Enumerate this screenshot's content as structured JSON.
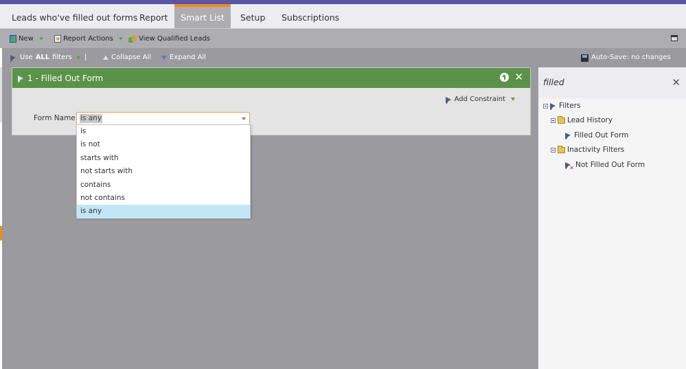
{
  "tabs": [
    {
      "label": "Leads who've filled out forms",
      "active": false
    },
    {
      "label": "Report",
      "active": false
    },
    {
      "label": "Smart List",
      "active": true
    },
    {
      "label": "Setup",
      "active": false
    },
    {
      "label": "Subscriptions",
      "active": false
    }
  ],
  "toolbar": {
    "new_label": "New",
    "new_icon": "new-sheet-icon",
    "report_actions_label": "Report Actions",
    "report_actions_icon": "report-icon",
    "view_qualified_label": "View Qualified Leads",
    "view_qualified_icon": "people-icon",
    "window_icon": "window-icon"
  },
  "filterbar": {
    "use_prefix": "Use",
    "use_bold": "ALL",
    "use_suffix": "filters",
    "separator": "|",
    "collapse_all": "Collapse All",
    "expand_all": "Expand All",
    "autosave": "Auto-Save: no changes"
  },
  "filter_card": {
    "title": "1 - Filled Out Form",
    "add_constraint": "Add Constraint",
    "form_name_label": "Form Name:",
    "operator_value": "is any",
    "operator_options": [
      "is",
      "is not",
      "starts with",
      "not starts with",
      "contains",
      "not contains",
      "is any"
    ],
    "selected_option": "is any"
  },
  "right_panel": {
    "search_value": "filled",
    "close_icon": "close-icon",
    "tree": [
      {
        "label": "Filters",
        "level": 0,
        "icon": "filter-icon",
        "expandable": true
      },
      {
        "label": "Lead History",
        "level": 1,
        "icon": "folder-icon",
        "expandable": true
      },
      {
        "label": "Filled Out Form",
        "level": 2,
        "icon": "filter-icon",
        "expandable": false
      },
      {
        "label": "Inactivity Filters",
        "level": 1,
        "icon": "folder-icon",
        "expandable": true
      },
      {
        "label": "Not Filled Out Form",
        "level": 2,
        "icon": "filter-negated-icon",
        "expandable": false
      }
    ]
  },
  "colors": {
    "top_accent": "#5c54a4",
    "tab_active_border": "#f08a24",
    "card_header": "#5b9249",
    "dropdown_selected": "#c3e6f7",
    "canvas": "#9b9a9f"
  }
}
